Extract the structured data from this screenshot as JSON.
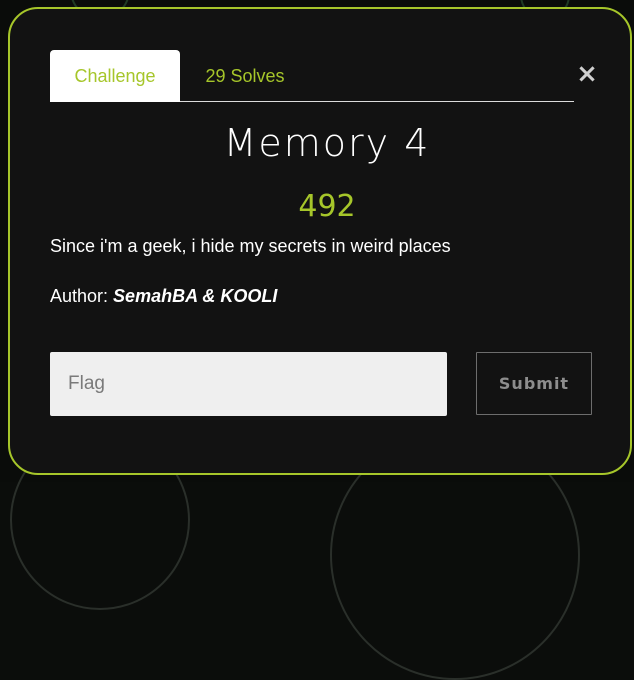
{
  "modal": {
    "close_glyph": "×",
    "tabs": [
      {
        "label": "Challenge",
        "active": true
      },
      {
        "label": "29 Solves",
        "active": false
      }
    ],
    "title": "Memory 4",
    "points": "492",
    "description": "Since i'm a geek, i hide my secrets in weird places",
    "author_prefix": "Author: ",
    "author_name": "SemahBA & KOOLI",
    "flag_placeholder": "Flag",
    "flag_value": "",
    "submit_label": "Submit"
  },
  "colors": {
    "accent": "#a6c62a",
    "modal_bg": "#121212",
    "input_bg": "#efefef"
  }
}
